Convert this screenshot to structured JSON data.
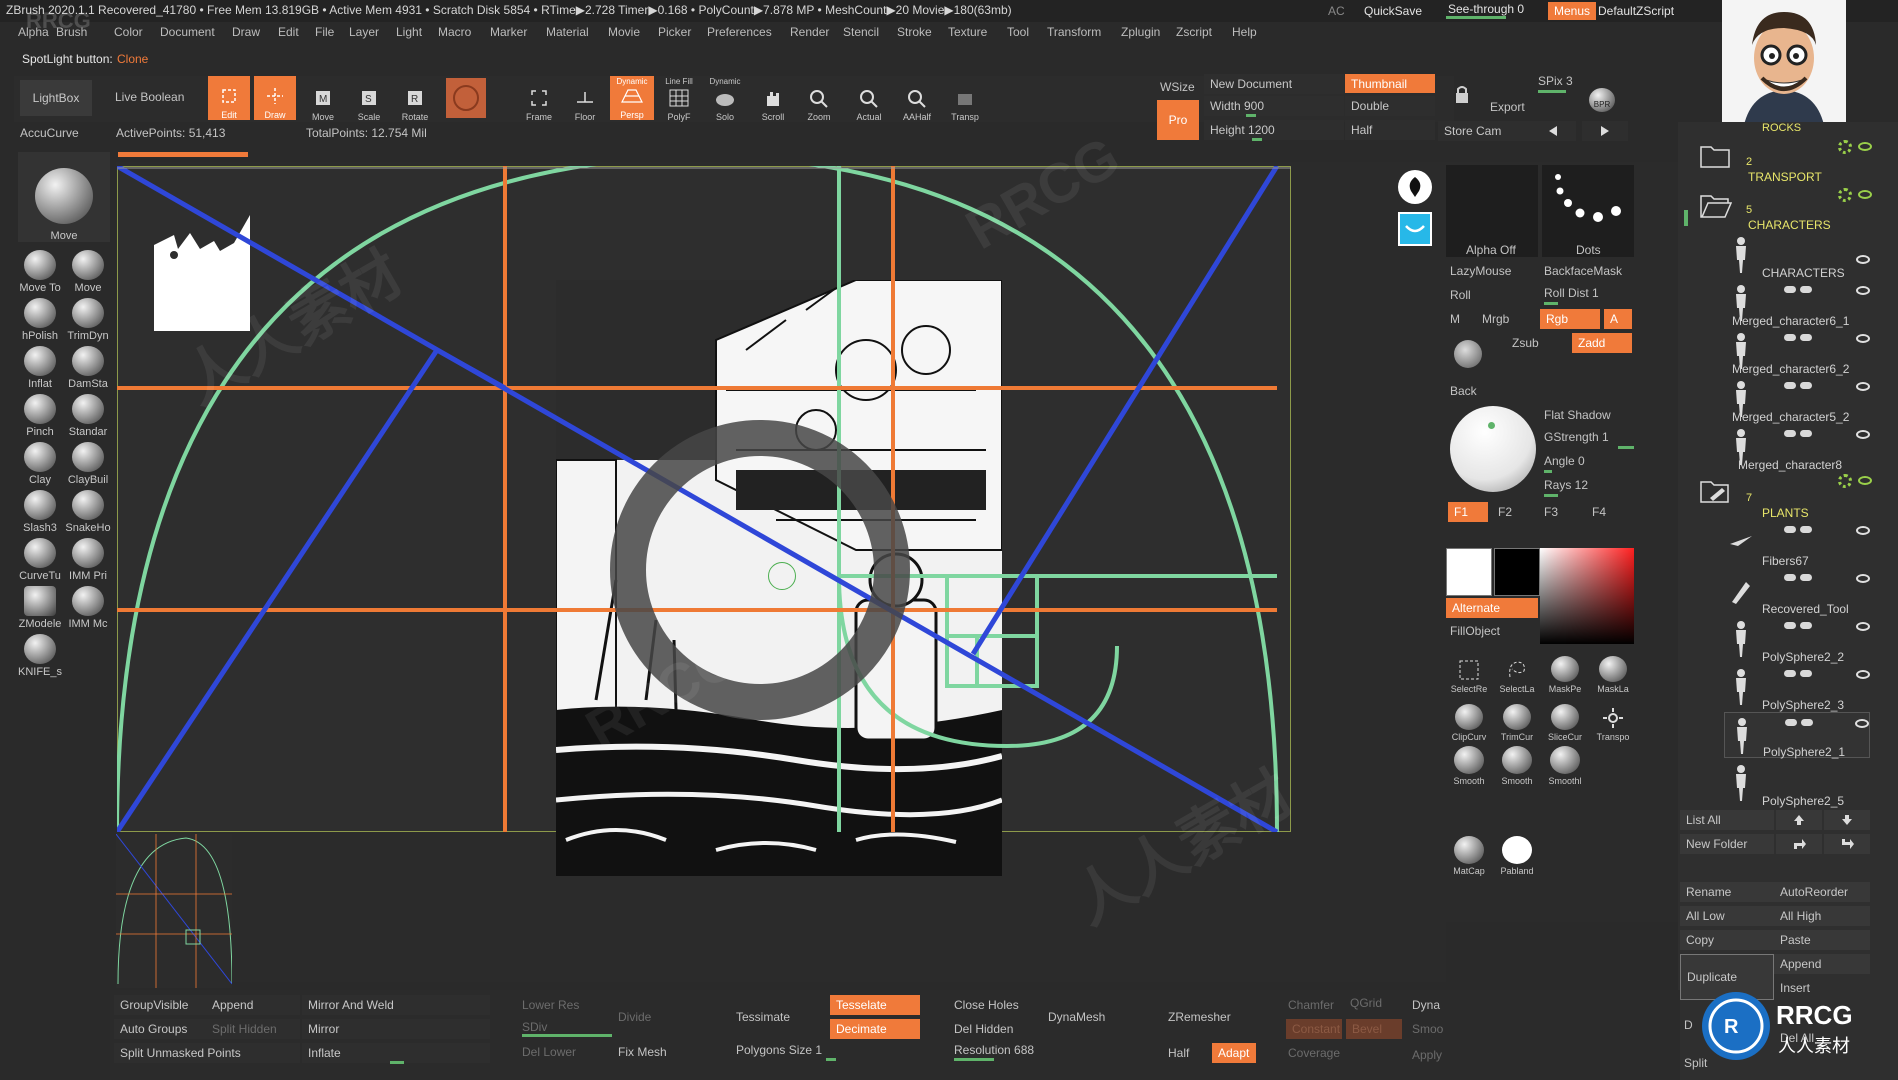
{
  "titlebar": {
    "text": "ZBrush 2020.1.1   Recovered_41780   • Free Mem 13.819GB • Active Mem 4931 • Scratch Disk 5854 •  RTime▶2.728 Timer▶0.168 • PolyCount▶7.878 MP  • MeshCount▶20  Movie▶180(63mb)",
    "ac": "AC",
    "quicksave": "QuickSave",
    "seethrough": "See-through  0",
    "menus": "Menus",
    "defaultzscript": "DefaultZScript"
  },
  "menubar": [
    "Alpha",
    "Brush",
    "Color",
    "Document",
    "Draw",
    "Edit",
    "File",
    "Layer",
    "Light",
    "Macro",
    "Marker",
    "Material",
    "Movie",
    "Picker",
    "Preferences",
    "Render",
    "Stencil",
    "Stroke",
    "Texture",
    "Tool",
    "Transform",
    "Zplugin",
    "Zscript",
    "Help"
  ],
  "spotlight": {
    "label": "SpotLight button:",
    "value": "Clone"
  },
  "toolbar": {
    "lightbox": "LightBox",
    "live_boolean": "Live Boolean",
    "edit": "Edit",
    "draw": "Draw",
    "move": "Move",
    "scale": "Scale",
    "rotate": "Rotate",
    "frame": "Frame",
    "floor": "Floor",
    "persp_top": "Dynamic",
    "persp": "Persp",
    "polyf_top": "Line Fill",
    "polyf": "PolyF",
    "solo_top": "Dynamic",
    "solo": "Solo",
    "scroll": "Scroll",
    "zoom": "Zoom",
    "actual": "Actual",
    "aahalf": "AAHalf",
    "transp": "Transp"
  },
  "document_panel": {
    "wsize": "WSize",
    "pro": "Pro",
    "new_document": "New Document",
    "thumbnail": "Thumbnail",
    "width": "Width 900",
    "double": "Double",
    "height": "Height 1200",
    "half": "Half",
    "export": "Export",
    "store_cam": "Store Cam",
    "spix": "SPix 3",
    "bpr": "BPR"
  },
  "status": {
    "accucurve": "AccuCurve",
    "active_points": "ActivePoints: 51,413",
    "total_points": "TotalPoints: 12.754 Mil"
  },
  "brushes": [
    {
      "label": "Move"
    },
    {
      "label": "Move To"
    },
    {
      "label": "Move"
    },
    {
      "label": "hPolish"
    },
    {
      "label": "TrimDyn"
    },
    {
      "label": "Inflat"
    },
    {
      "label": "DamSta"
    },
    {
      "label": "Pinch"
    },
    {
      "label": "Standar"
    },
    {
      "label": "Clay"
    },
    {
      "label": "ClayBuil"
    },
    {
      "label": "Slash3"
    },
    {
      "label": "SnakeHo"
    },
    {
      "label": "CurveTu"
    },
    {
      "label": "IMM Pri"
    },
    {
      "label": "ZModele"
    },
    {
      "label": "IMM Mc"
    },
    {
      "label": "KNIFE_s"
    }
  ],
  "right_panel": {
    "alpha_off": "Alpha Off",
    "dots": "Dots",
    "lazymouse": "LazyMouse",
    "backfacemask": "BackfaceMask",
    "roll": "Roll",
    "roll_dist": "Roll Dist 1",
    "m": "M",
    "mrgb": "Mrgb",
    "rgb": "Rgb",
    "a": "A",
    "zsub": "Zsub",
    "zadd": "Zadd",
    "back": "Back",
    "flat_shadow": "Flat Shadow",
    "gstrength": "GStrength 1",
    "angle": "Angle 0",
    "rays": "Rays 12",
    "f1": "F1",
    "f2": "F2",
    "f3": "F3",
    "f4": "F4",
    "alternate": "Alternate",
    "fillobject": "FillObject",
    "tools_row1": [
      "SelectRe",
      "SelectLa",
      "MaskPe",
      "MaskLa"
    ],
    "tools_row2": [
      "ClipCurv",
      "TrimCur",
      "SliceCur",
      "Transpo"
    ],
    "tools_row3": [
      "Smooth",
      "Smooth",
      "Smoothl"
    ],
    "matcap": "MatCap",
    "pabland": "Pabland"
  },
  "subtool": {
    "rocks": "ROCKS",
    "transport_count": "2",
    "transport": "TRANSPORT",
    "characters_count": "5",
    "characters": "CHARACTERS",
    "items": [
      {
        "name": "CHARACTERS"
      },
      {
        "name": "Merged_character6_1"
      },
      {
        "name": "Merged_character6_2"
      },
      {
        "name": "Merged_character5_2"
      },
      {
        "name": "Merged_character8"
      }
    ],
    "plants_count": "7",
    "plants": "PLANTS",
    "items2": [
      {
        "name": "Fibers67"
      },
      {
        "name": "Recovered_Tool"
      },
      {
        "name": "PolySphere2_2"
      },
      {
        "name": "PolySphere2_3"
      },
      {
        "name": "PolySphere2_1"
      },
      {
        "name": "PolySphere2_5"
      }
    ],
    "list_all": "List All",
    "new_folder": "New Folder",
    "rename": "Rename",
    "autoreorder": "AutoReorder",
    "all_low": "All Low",
    "all_high": "All High",
    "copy": "Copy",
    "paste": "Paste",
    "duplicate": "Duplicate",
    "append": "Append",
    "insert": "Insert",
    "del_all": "Del All",
    "d": "D",
    "split": "Split"
  },
  "bottom": {
    "groupvisible": "GroupVisible",
    "append": "Append",
    "mirror_weld": "Mirror And Weld",
    "auto_groups": "Auto Groups",
    "split_hidden": "Split Hidden",
    "mirror": "Mirror",
    "split_unmasked": "Split Unmasked Points",
    "inflate": "Inflate",
    "lower_res": "Lower Res",
    "divide": "Divide",
    "sdiv": "SDiv",
    "del_lower": "Del Lower",
    "fix_mesh": "Fix Mesh",
    "tessimate": "Tessimate",
    "tesselate": "Tesselate",
    "decimate": "Decimate",
    "polygons_size": "Polygons Size 1",
    "close_holes": "Close Holes",
    "dynamesh": "DynaMesh",
    "del_hidden": "Del Hidden",
    "resolution": "Resolution 688",
    "zremesher": "ZRemesher",
    "half": "Half",
    "adapt": "Adapt",
    "chamfer": "Chamfer",
    "qgrid": "QGrid",
    "dyna": "Dyna",
    "constant": "Constant",
    "bevel": "Bevel",
    "smooth": "Smoo",
    "coverage": "Coverage",
    "apply": "Apply"
  },
  "watermarks": [
    "RRCG",
    "人人素材"
  ],
  "colors": {
    "accent": "#f07a3a",
    "guide_blue": "#2f47d8",
    "guide_green": "#7fd6a0",
    "guide_orange": "#ef7a35",
    "bg": "#2a2a2a"
  }
}
